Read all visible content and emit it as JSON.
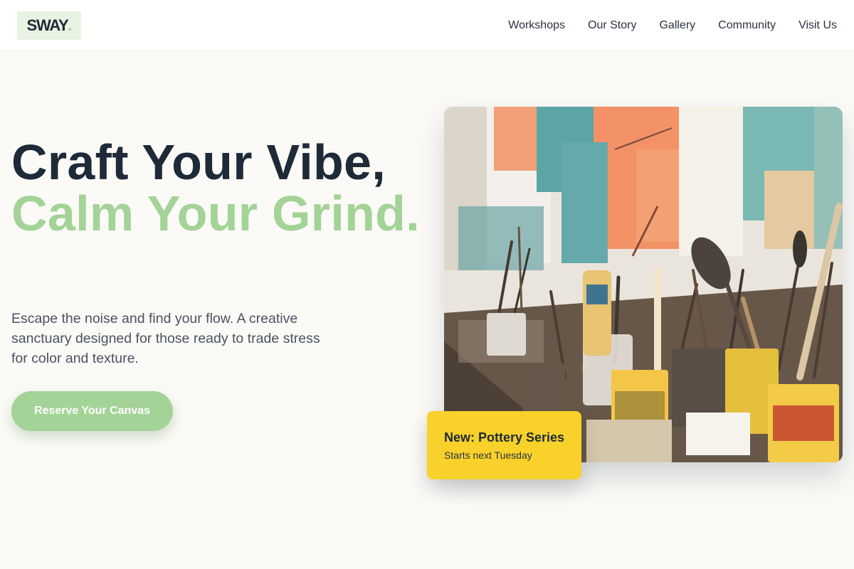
{
  "brand": {
    "name": "SWAY",
    "accent": "#a3d396",
    "dark": "#1e2a38"
  },
  "nav": {
    "items": [
      {
        "label": "Workshops"
      },
      {
        "label": "Our Story"
      },
      {
        "label": "Gallery"
      },
      {
        "label": "Community"
      },
      {
        "label": "Visit Us"
      }
    ]
  },
  "hero": {
    "headline_line1": "Craft Your Vibe,",
    "headline_line2": "Calm Your Grind.",
    "subtext": "Escape the noise and find your flow. A creative sanctuary designed for those ready to trade stress for color and texture.",
    "cta_label": "Reserve Your Canvas"
  },
  "image": {
    "description_icon": "art-studio-photo"
  },
  "badge": {
    "title": "New: Pottery Series",
    "subtitle": "Starts next Tuesday",
    "color": "#f8d12a"
  }
}
